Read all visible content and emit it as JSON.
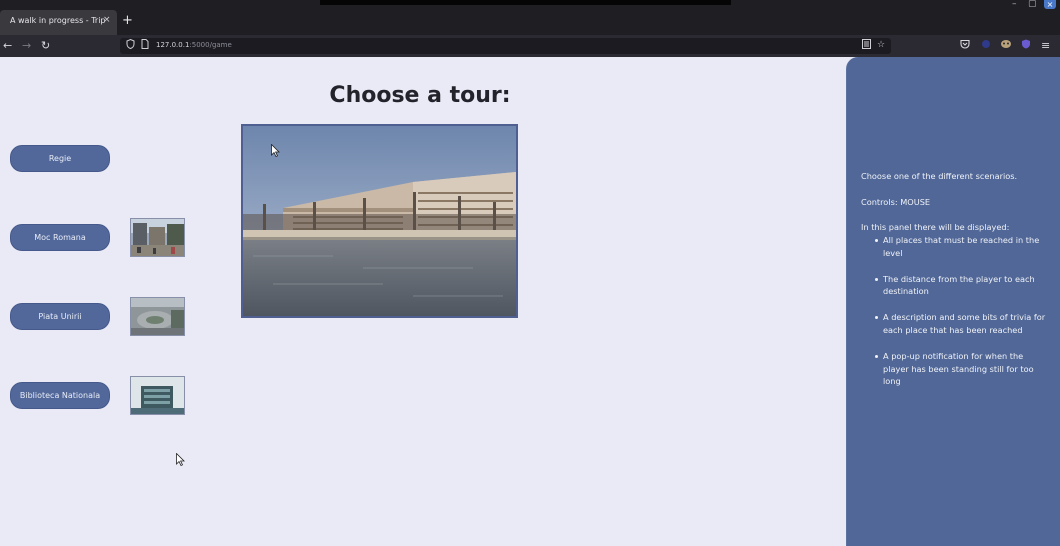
{
  "browser": {
    "tab_title": "A walk in progress - Trip",
    "tab_close": "×",
    "new_tab": "+",
    "url_host": "127.0.0.1",
    "url_rest": ":5000/game",
    "window_controls": [
      "–",
      "▢",
      "×"
    ]
  },
  "page": {
    "heading": "Choose a tour:",
    "tours": [
      {
        "label": "Regie"
      },
      {
        "label": "Moc Romana"
      },
      {
        "label": "Piata Unirii"
      },
      {
        "label": "Biblioteca Nationala"
      }
    ]
  },
  "panel": {
    "intro": "Choose one of the different scenarios.",
    "controls": "Controls: MOUSE",
    "list_title": "In this panel there will be displayed:",
    "items": [
      "All places that must be reached in the level",
      "The distance from the player to each destination",
      "A description and some bits of trivia for each place that has been reached",
      "A pop-up notification for when the player has been standing still for too long"
    ]
  },
  "icons": {
    "back": "arrow-left-icon",
    "forward": "arrow-right-icon",
    "reload": "reload-icon",
    "shield": "shield-icon",
    "page": "page-icon",
    "reader": "reader-view-icon",
    "bookmark": "star-icon",
    "pocket": "pocket-icon",
    "extension1": "extension-icon",
    "extension2": "extension-icon",
    "menu": "hamburger-menu-icon"
  },
  "colors": {
    "page_bg": "#e9eaf5",
    "button_bg": "#52689a",
    "panel_bg": "#506797",
    "preview_border": "#4f5f92"
  }
}
